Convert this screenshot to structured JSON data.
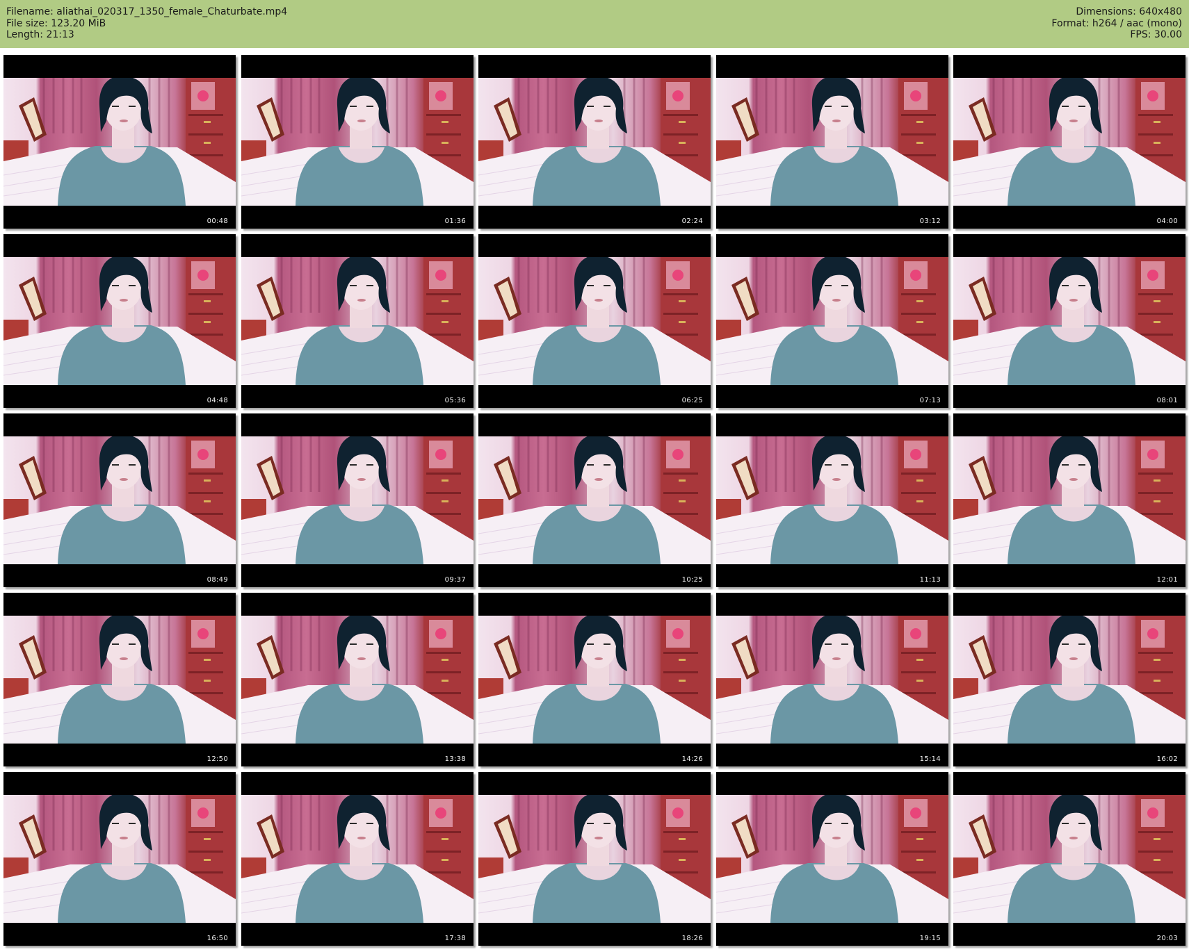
{
  "header": {
    "filename": "Filename: aliathai_020317_1350_female_Chaturbate.mp4",
    "filesize": "File size: 123.20 MiB",
    "length": "Length: 21:13",
    "dimensions": "Dimensions: 640x480",
    "format": "Format: h264 / aac (mono)",
    "fps": "FPS: 30.00"
  },
  "colors": {
    "header_bg": "#b1cb84",
    "curtain": "#b4577f",
    "cabinet": "#a2363c",
    "sweater": "#6b97a5",
    "bed": "#f4edf3"
  },
  "thumbnails": [
    {
      "time": "00:48"
    },
    {
      "time": "01:36"
    },
    {
      "time": "02:24"
    },
    {
      "time": "03:12"
    },
    {
      "time": "04:00"
    },
    {
      "time": "04:48"
    },
    {
      "time": "05:36"
    },
    {
      "time": "06:25"
    },
    {
      "time": "07:13"
    },
    {
      "time": "08:01"
    },
    {
      "time": "08:49"
    },
    {
      "time": "09:37"
    },
    {
      "time": "10:25"
    },
    {
      "time": "11:13"
    },
    {
      "time": "12:01"
    },
    {
      "time": "12:50"
    },
    {
      "time": "13:38"
    },
    {
      "time": "14:26"
    },
    {
      "time": "15:14"
    },
    {
      "time": "16:02"
    },
    {
      "time": "16:50"
    },
    {
      "time": "17:38"
    },
    {
      "time": "18:26"
    },
    {
      "time": "19:15"
    },
    {
      "time": "20:03"
    }
  ]
}
